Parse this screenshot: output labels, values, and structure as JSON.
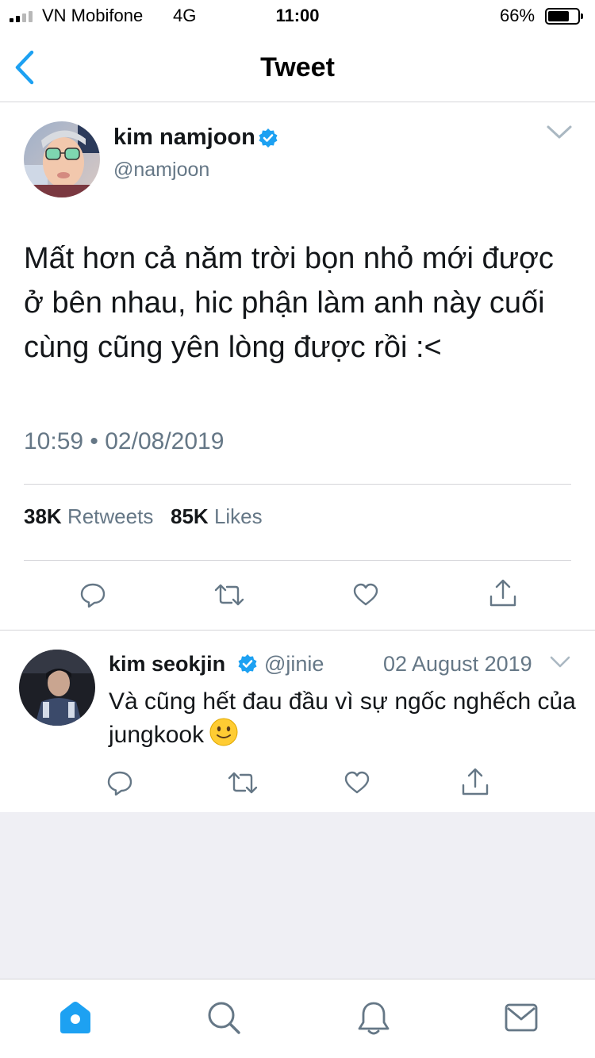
{
  "status_bar": {
    "carrier": "VN Mobifone",
    "network": "4G",
    "time": "11:00",
    "battery": "66%"
  },
  "nav": {
    "title": "Tweet",
    "back_icon": "chevron-left-icon"
  },
  "tweet": {
    "author_name": "kim namjoon",
    "author_handle": "@namjoon",
    "verified": true,
    "text": "Mất hơn cả năm trời bọn nhỏ mới được ở bên nhau, hic phận làm anh này cuối cùng cũng yên lòng được rồi :<",
    "timestamp": "10:59 • 02/08/2019",
    "retweets_count": "38K",
    "retweets_label": "Retweets",
    "likes_count": "85K",
    "likes_label": "Likes"
  },
  "reply": {
    "author_name": "kim seokjin",
    "author_handle": "@jinie",
    "verified": true,
    "date": "02 August 2019",
    "text": "Và cũng hết đau đầu vì sự ngốc nghếch của jungkook",
    "emoji": "slightly-smiling-face"
  },
  "tab_bar": [
    "home-icon",
    "search-icon",
    "bell-icon",
    "envelope-icon"
  ],
  "colors": {
    "accent": "#1da1f2",
    "text_secondary": "#657786",
    "background_gray": "#efeff4"
  }
}
